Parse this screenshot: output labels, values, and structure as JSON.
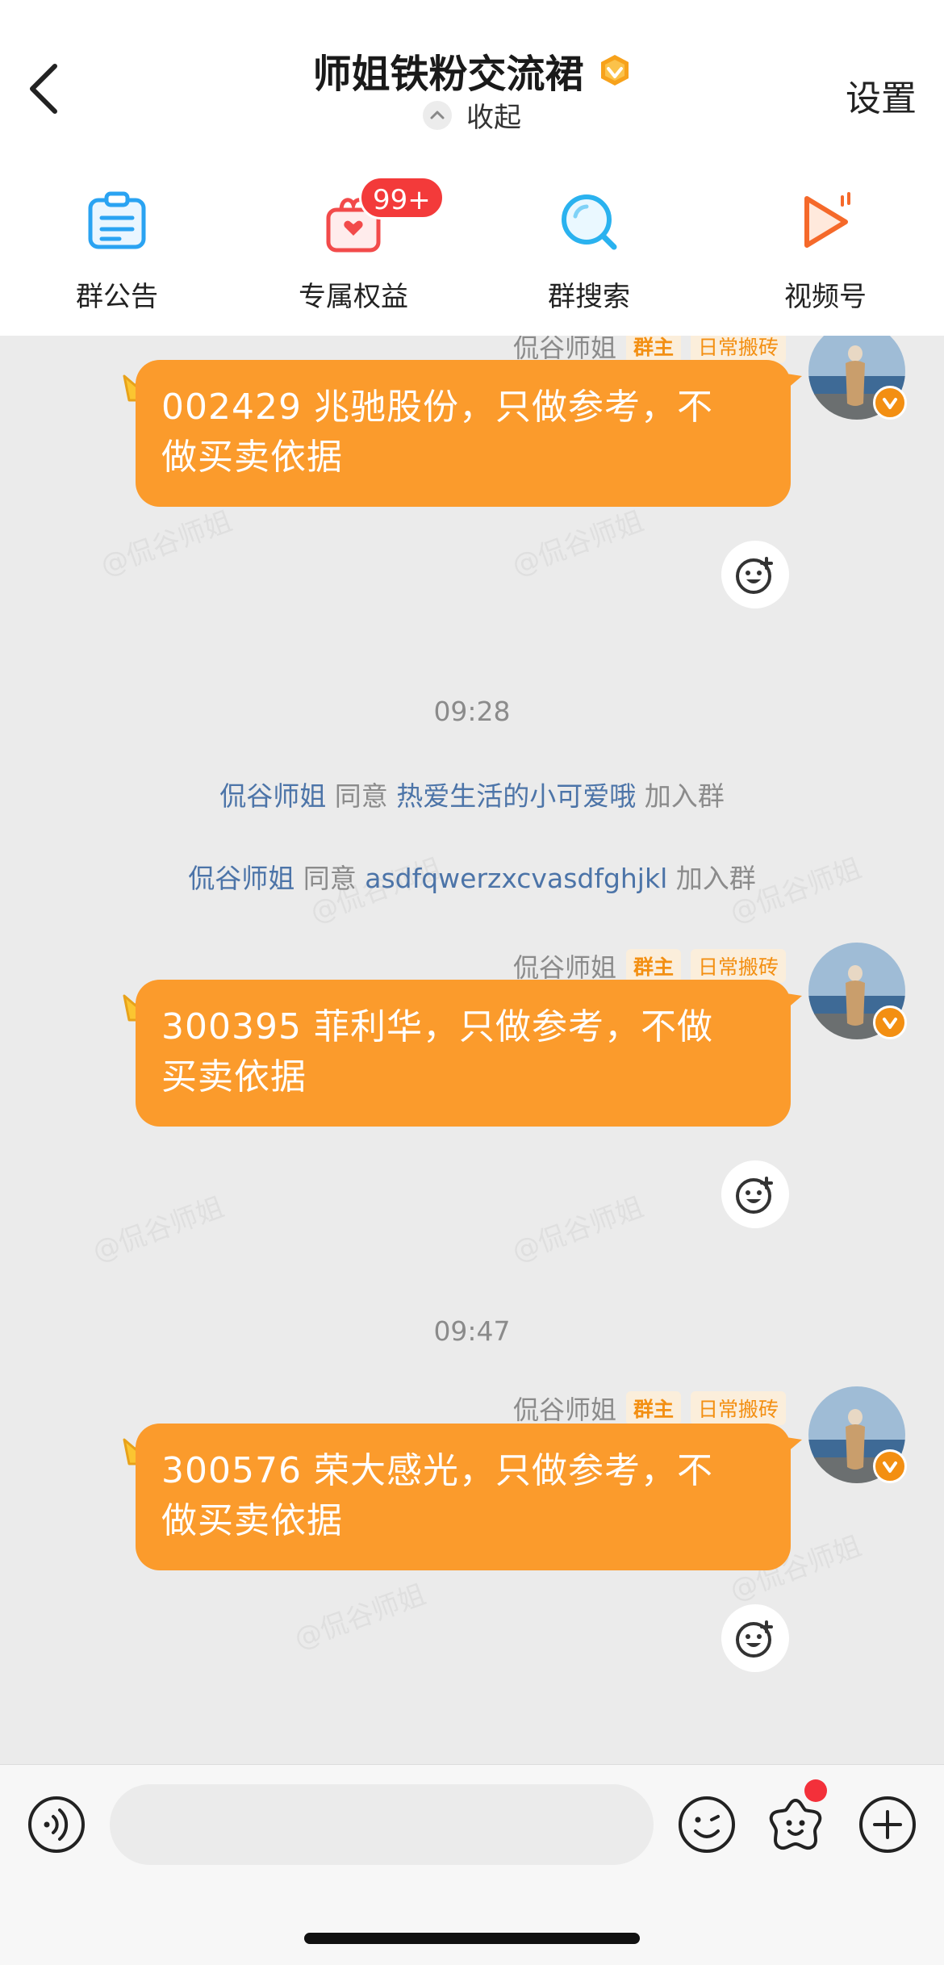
{
  "header": {
    "title": "师姐铁粉交流裙",
    "collapse_label": "收起",
    "settings_label": "设置",
    "quick_actions": [
      {
        "label": "群公告",
        "icon": "announcement-icon"
      },
      {
        "label": "专属权益",
        "icon": "gift-icon",
        "badge": "99+"
      },
      {
        "label": "群搜索",
        "icon": "search-icon"
      },
      {
        "label": "视频号",
        "icon": "video-icon"
      }
    ]
  },
  "watermark_text": "@侃谷师姐",
  "messages": [
    {
      "sender": "侃谷师姐",
      "role_tag": "群主",
      "title_tag": "日常搬砖",
      "text_line1": "002429 兆驰股份，只做参考，不",
      "text_line2": "做买卖依据"
    },
    {
      "sender": "侃谷师姐",
      "role_tag": "群主",
      "title_tag": "日常搬砖",
      "text_line1": "300395 菲利华，只做参考，不做",
      "text_line2": "买卖依据"
    },
    {
      "sender": "侃谷师姐",
      "role_tag": "群主",
      "title_tag": "日常搬砖",
      "text_line1": "300576 荣大感光，只做参考，不",
      "text_line2": "做买卖依据"
    }
  ],
  "times": [
    "09:28",
    "09:47"
  ],
  "system_messages": [
    {
      "actor": "侃谷师姐",
      "verb": "同意",
      "target": "热爱生活的小可爱哦",
      "action": "加入群"
    },
    {
      "actor": "侃谷师姐",
      "verb": "同意",
      "target": "asdfqwerzxcvasdfghjkl",
      "action": "加入群"
    }
  ],
  "colors": {
    "bubble": "#fb9b2c",
    "tag_text": "#f38f12",
    "link": "#4c74a8",
    "badge": "#f33a3a"
  }
}
